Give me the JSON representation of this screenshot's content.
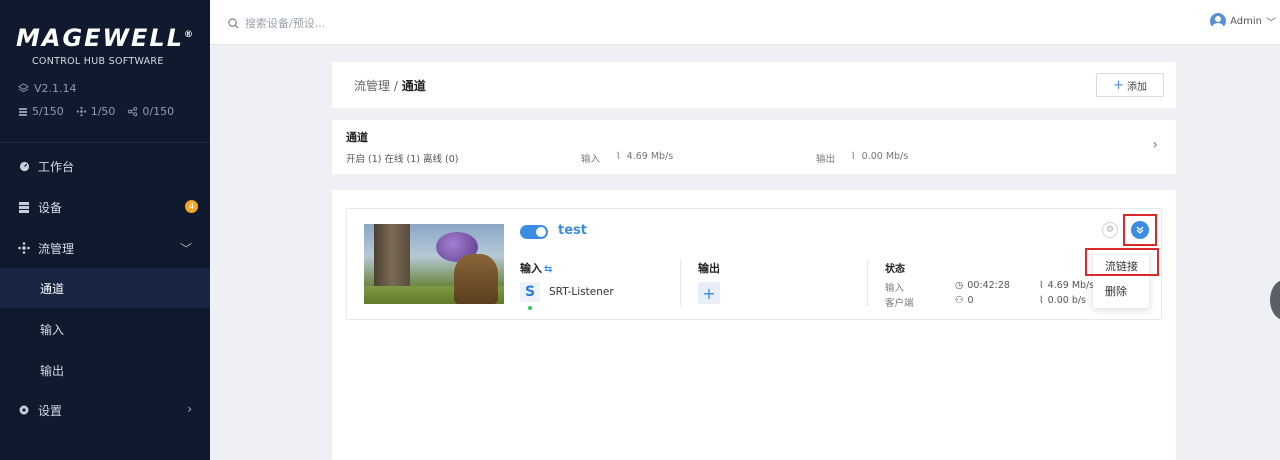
{
  "sidebar": {
    "logo": "MAGEWELL",
    "logo_mark": "®",
    "subtitle": "CONTROL HUB SOFTWARE",
    "version": "V2.1.14",
    "counts": [
      {
        "icon": "server-icon",
        "value": "5/150"
      },
      {
        "icon": "network-icon",
        "value": "1/50"
      },
      {
        "icon": "share-icon",
        "value": "0/150"
      }
    ],
    "nav": {
      "dashboard": "工作台",
      "devices": "设备",
      "devices_badge": "4",
      "stream_mgmt": "流管理",
      "channels": "通道",
      "inputs": "输入",
      "outputs": "输出",
      "settings": "设置"
    }
  },
  "topbar": {
    "search_placeholder": "搜索设备/预设...",
    "user": "Admin"
  },
  "breadcrumb": {
    "parent": "流管理",
    "separator": " / ",
    "current": "通道",
    "add_label": "添加"
  },
  "summary": {
    "title": "通道",
    "stats": "开启 (1)  在线 (1)  离线 (0)",
    "input_label": "输入",
    "input_rate": "4.69 Mb/s",
    "output_label": "输出",
    "output_rate": "0.00 Mb/s"
  },
  "channel": {
    "name": "test",
    "enabled": true,
    "input_header": "输入",
    "output_header": "输出",
    "status_header": "状态",
    "input_protocol_badge": "S",
    "input_name": "SRT-Listener",
    "status": {
      "input_label": "输入",
      "duration": "00:42:28",
      "in_rate": "4.69 Mb/s",
      "clients_label": "客户端",
      "clients": "0",
      "out_rate": "0.00 b/s"
    },
    "menu": {
      "stream_link": "流链接",
      "delete": "删除"
    }
  },
  "colors": {
    "accent": "#3b8de3",
    "sidebar_bg": "#0f1a2e",
    "highlight": "#d92b2b",
    "badge": "#f5a623"
  }
}
